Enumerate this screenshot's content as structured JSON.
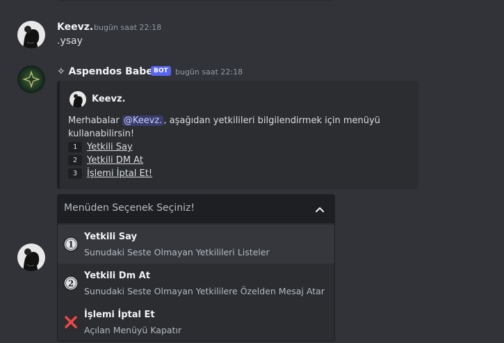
{
  "messages": [
    {
      "username": "Keevz.",
      "timestamp": "bugün saat 22:18",
      "text": ".ysay"
    },
    {
      "username": "✧ Aspendos Babes",
      "bot_tag": "BOT",
      "timestamp": "bugün saat 22:18"
    }
  ],
  "embed": {
    "author": "Keevz.",
    "desc_prefix": "Merhabalar ",
    "mention": "@Keevz.",
    "desc_suffix": ", aşağıdan yetkilileri bilgilendirmek için menüyü kullanabilirsin!",
    "items": [
      {
        "num": "1",
        "label": "Yetkili Say"
      },
      {
        "num": "2",
        "label": "Yetkili DM At"
      },
      {
        "num": "3",
        "label": "İşlemi İptal Et!"
      }
    ]
  },
  "select_menu": {
    "placeholder": "Menüden Seçenek Seçiniz!",
    "options": [
      {
        "icon": "digit-one-icon",
        "label": "Yetkili Say",
        "description": "Sunudaki Seste Olmayan Yetkilileri Listeler"
      },
      {
        "icon": "digit-two-icon",
        "label": "Yetkili Dm At",
        "description": "Sunudaki Seste Olmayan Yetkililere Özelden Mesaj Atar"
      },
      {
        "icon": "cross-mark-icon",
        "label": "İşlemi İptal Et",
        "description": "Açılan Menüyü Kapatır"
      }
    ]
  },
  "colors": {
    "background": "#313338",
    "embed_bg": "#2b2d31",
    "menu_bg": "#1e1f22",
    "bot_tag": "#5865f2",
    "cross": "#f04747"
  }
}
